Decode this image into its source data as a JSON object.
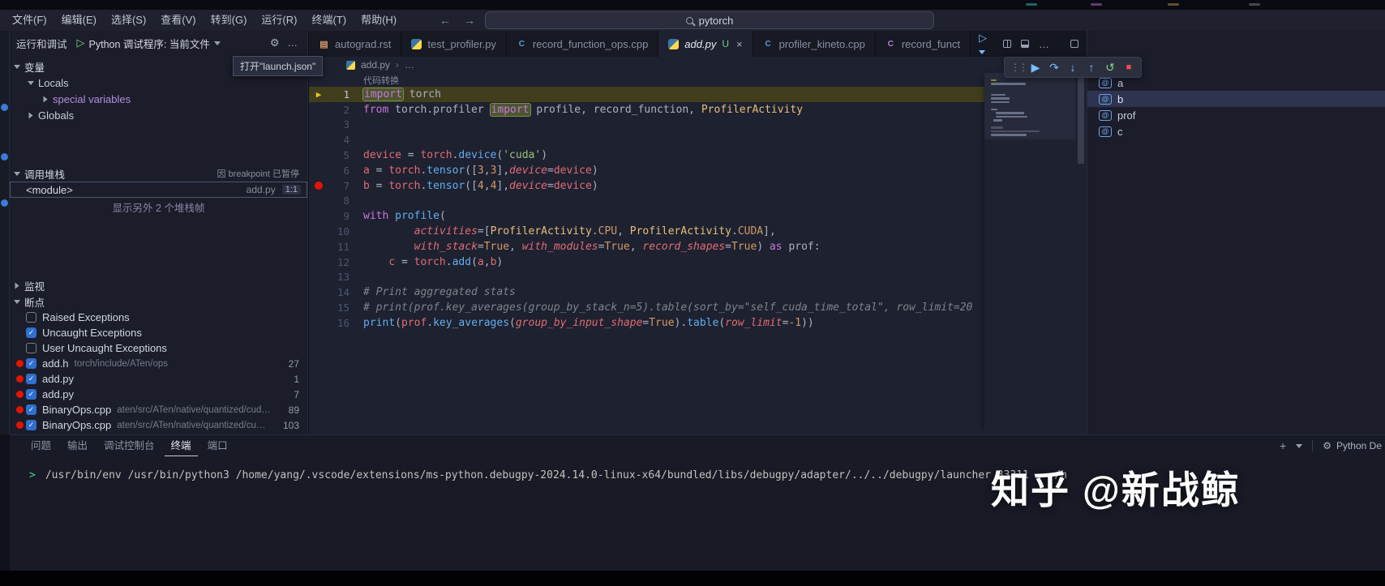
{
  "window": {
    "search_value": "pytorch",
    "watermark": "知乎 @新战鲸"
  },
  "menubar": {
    "items": [
      "文件(F)",
      "编辑(E)",
      "选择(S)",
      "查看(V)",
      "转到(G)",
      "运行(R)",
      "终端(T)",
      "帮助(H)"
    ]
  },
  "run_panel": {
    "title": "运行和调试",
    "config_label": "Python 调试程序: 当前文件",
    "tooltip": "打开\"launch.json\"",
    "variables": {
      "header": "变量",
      "locals": "Locals",
      "special": "special variables",
      "globals": "Globals"
    },
    "callstack": {
      "header": "调用堆栈",
      "status": "因 breakpoint 已暂停",
      "frame": "<module>",
      "frame_file": "add.py",
      "frame_pos": "1:1",
      "show_more": "显示另外 2 个堆栈帧"
    },
    "watch_header": "监视",
    "breakpoints": {
      "header": "断点",
      "items": [
        {
          "checked": false,
          "dot": false,
          "label": "Raised Exceptions",
          "path": "",
          "line": ""
        },
        {
          "checked": true,
          "dot": false,
          "label": "Uncaught Exceptions",
          "path": "",
          "line": ""
        },
        {
          "checked": false,
          "dot": false,
          "label": "User Uncaught Exceptions",
          "path": "",
          "line": ""
        },
        {
          "checked": true,
          "dot": true,
          "label": "add.h",
          "path": "torch/include/ATen/ops",
          "line": "27"
        },
        {
          "checked": true,
          "dot": true,
          "label": "add.py",
          "path": "",
          "line": "1"
        },
        {
          "checked": true,
          "dot": true,
          "label": "add.py",
          "path": "",
          "line": "7"
        },
        {
          "checked": true,
          "dot": true,
          "label": "BinaryOps.cpp",
          "path": "aten/src/ATen/native/quantized/cud…",
          "line": "89"
        },
        {
          "checked": true,
          "dot": true,
          "label": "BinaryOps.cpp",
          "path": "aten/src/ATen/native/quantized/cu…",
          "line": "103"
        }
      ]
    }
  },
  "tabs": [
    {
      "label": "autograd.rst",
      "icon": "rst",
      "active": false
    },
    {
      "label": "test_profiler.py",
      "icon": "py",
      "active": false
    },
    {
      "label": "record_function_ops.cpp",
      "icon": "cpp",
      "active": false
    },
    {
      "label": "add.py",
      "icon": "py",
      "active": true,
      "italic": true,
      "badge": "U",
      "close": "×"
    },
    {
      "label": "profiler_kineto.cpp",
      "icon": "cpp",
      "active": false
    },
    {
      "label": "record_funct",
      "icon": "c",
      "active": false
    }
  ],
  "breadcrumb": {
    "file": "add.py",
    "more": "…"
  },
  "editor": {
    "codelens": "代码转换",
    "lines": [
      {
        "n": 1,
        "cur": true,
        "mark": "arrow",
        "t": [
          [
            "import",
            "k b"
          ],
          [
            " ",
            "d"
          ],
          [
            "torch",
            "d"
          ]
        ]
      },
      {
        "n": 2,
        "t": [
          [
            "from",
            "k"
          ],
          [
            " torch.profiler ",
            "d"
          ],
          [
            "import",
            "k b"
          ],
          [
            " profile, record_function, ",
            "d"
          ],
          [
            "ProfilerActivity",
            "cl"
          ]
        ]
      },
      {
        "n": 3,
        "t": []
      },
      {
        "n": 4,
        "t": []
      },
      {
        "n": 5,
        "t": [
          [
            "device",
            "v"
          ],
          [
            " = ",
            "d"
          ],
          [
            "torch",
            "v"
          ],
          [
            ".",
            "d"
          ],
          [
            "device",
            "f"
          ],
          [
            "(",
            "d"
          ],
          [
            "'cuda'",
            "s"
          ],
          [
            ")",
            "d"
          ]
        ]
      },
      {
        "n": 6,
        "t": [
          [
            "a",
            "v"
          ],
          [
            " = ",
            "d"
          ],
          [
            "torch",
            "v"
          ],
          [
            ".",
            "d"
          ],
          [
            "tensor",
            "f"
          ],
          [
            "([",
            "d"
          ],
          [
            "3",
            "n"
          ],
          [
            ",",
            "d"
          ],
          [
            "3",
            "n"
          ],
          [
            "],",
            "d"
          ],
          [
            "device",
            "p"
          ],
          [
            "=",
            "d"
          ],
          [
            "device",
            "v"
          ],
          [
            ")",
            "d"
          ]
        ]
      },
      {
        "n": 7,
        "mark": "bp",
        "t": [
          [
            "b",
            "v"
          ],
          [
            " = ",
            "d"
          ],
          [
            "torch",
            "v"
          ],
          [
            ".",
            "d"
          ],
          [
            "tensor",
            "f"
          ],
          [
            "([",
            "d"
          ],
          [
            "4",
            "n"
          ],
          [
            ",",
            "d"
          ],
          [
            "4",
            "n"
          ],
          [
            "],",
            "d"
          ],
          [
            "device",
            "p"
          ],
          [
            "=",
            "d"
          ],
          [
            "device",
            "v"
          ],
          [
            ")",
            "d"
          ]
        ]
      },
      {
        "n": 8,
        "t": []
      },
      {
        "n": 9,
        "t": [
          [
            "with",
            "k"
          ],
          [
            " ",
            "d"
          ],
          [
            "profile",
            "f"
          ],
          [
            "(",
            "d"
          ]
        ]
      },
      {
        "n": 10,
        "t": [
          [
            "        ",
            "d"
          ],
          [
            "activities",
            "p"
          ],
          [
            "=[",
            "d"
          ],
          [
            "ProfilerActivity",
            "cl"
          ],
          [
            ".",
            "d"
          ],
          [
            "CPU",
            "n"
          ],
          [
            ", ",
            "d"
          ],
          [
            "ProfilerActivity",
            "cl"
          ],
          [
            ".",
            "d"
          ],
          [
            "CUDA",
            "n"
          ],
          [
            "],",
            "d"
          ]
        ]
      },
      {
        "n": 11,
        "t": [
          [
            "        ",
            "d"
          ],
          [
            "with_stack",
            "p"
          ],
          [
            "=",
            "d"
          ],
          [
            "True",
            "n"
          ],
          [
            ", ",
            "d"
          ],
          [
            "with_modules",
            "p"
          ],
          [
            "=",
            "d"
          ],
          [
            "True",
            "n"
          ],
          [
            ", ",
            "d"
          ],
          [
            "record_shapes",
            "p"
          ],
          [
            "=",
            "d"
          ],
          [
            "True",
            "n"
          ],
          [
            ") ",
            "d"
          ],
          [
            "as",
            "k"
          ],
          [
            " prof:",
            "d"
          ]
        ]
      },
      {
        "n": 12,
        "t": [
          [
            "    ",
            "d"
          ],
          [
            "c",
            "v"
          ],
          [
            " = ",
            "d"
          ],
          [
            "torch",
            "v"
          ],
          [
            ".",
            "d"
          ],
          [
            "add",
            "f"
          ],
          [
            "(",
            "d"
          ],
          [
            "a",
            "v"
          ],
          [
            ",",
            "d"
          ],
          [
            "b",
            "v"
          ],
          [
            ")",
            "d"
          ]
        ]
      },
      {
        "n": 13,
        "t": []
      },
      {
        "n": 14,
        "t": [
          [
            "# Print aggregated stats",
            "c"
          ]
        ]
      },
      {
        "n": 15,
        "t": [
          [
            "# print(prof.key_averages(group_by_stack_n=5).table(sort_by=\"self_cuda_time_total\", row_limit=20",
            "c"
          ]
        ]
      },
      {
        "n": 16,
        "t": [
          [
            "print",
            "f"
          ],
          [
            "(",
            "d"
          ],
          [
            "prof",
            "v"
          ],
          [
            ".",
            "d"
          ],
          [
            "key_averages",
            "f"
          ],
          [
            "(",
            "d"
          ],
          [
            "group_by_input_shape",
            "p"
          ],
          [
            "=",
            "d"
          ],
          [
            "True",
            "n"
          ],
          [
            ").",
            "d"
          ],
          [
            "table",
            "f"
          ],
          [
            "(",
            "d"
          ],
          [
            "row_limit",
            "p"
          ],
          [
            "=",
            "d"
          ],
          [
            "-1",
            "n"
          ],
          [
            "))",
            "d"
          ]
        ]
      }
    ]
  },
  "debug_toolbar": [
    "drag-handle",
    "continue",
    "step-over",
    "step-into",
    "step-out",
    "restart",
    "stop"
  ],
  "outline": {
    "items": [
      "a",
      "b",
      "prof",
      "c"
    ],
    "selected": "b"
  },
  "panel": {
    "tabs": [
      "问题",
      "输出",
      "调试控制台",
      "终端",
      "端口"
    ],
    "active_tab": "终端",
    "terminal_name": "Python De",
    "prompt": ">",
    "command": "/usr/bin/env /usr/bin/python3 /home/yang/.vscode/extensions/ms-python.debugpy-2024.14.0-linux-x64/bundled/libs/debugpy/adapter/../../debugpy/launcher 33311 -- /h"
  }
}
